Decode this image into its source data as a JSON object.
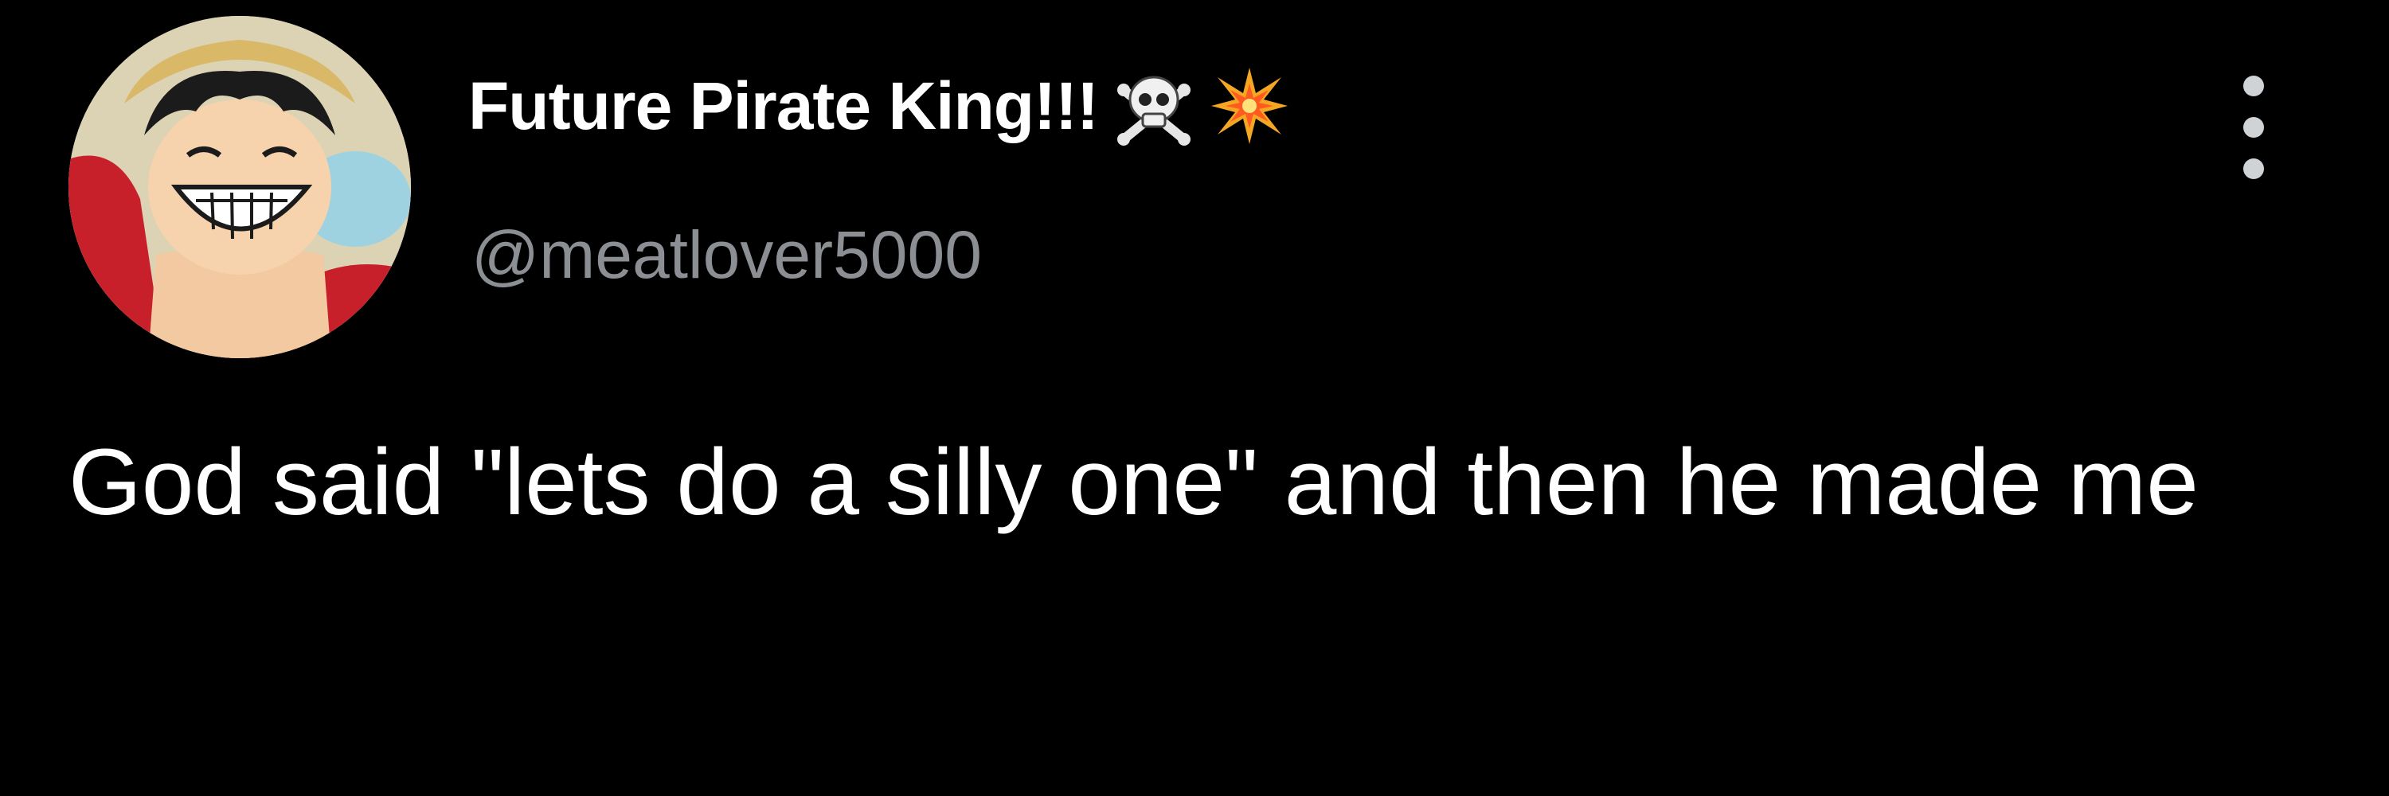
{
  "author": {
    "display_name": "Future Pirate King!!!",
    "display_name_emojis": [
      "skull-and-crossbones-icon",
      "collision-icon"
    ],
    "handle": "@meatlover5000",
    "avatar": "profile-avatar-anime-character"
  },
  "tweet": {
    "text": "God said \"lets do a silly one\" and then he made me"
  },
  "menu": {
    "more_icon": "vertical-ellipsis-icon"
  },
  "colors": {
    "background": "#000000",
    "primary_text": "#ffffff",
    "secondary_text": "#8b8f94"
  }
}
